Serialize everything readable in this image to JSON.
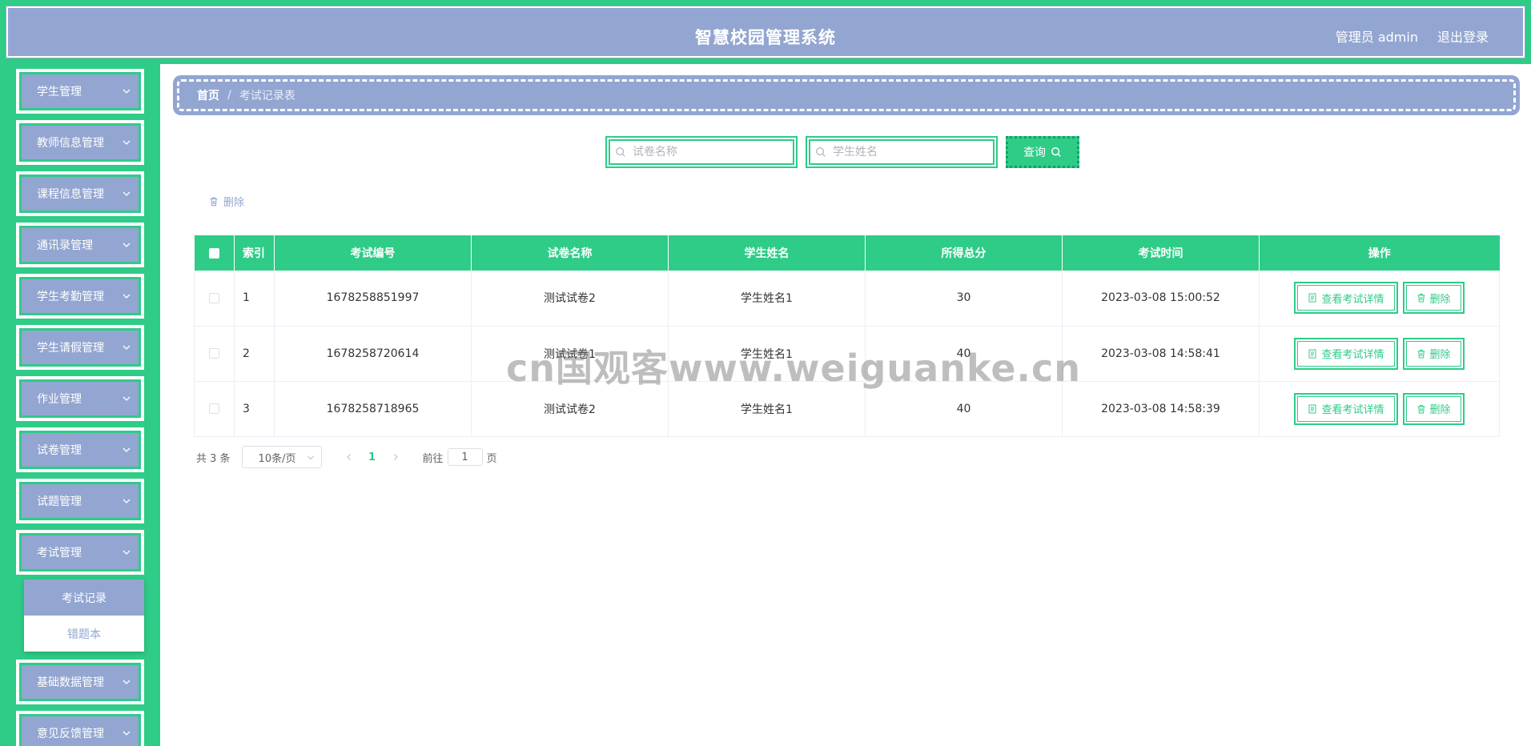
{
  "header": {
    "title": "智慧校园管理系统",
    "user": "管理员 admin",
    "logout": "退出登录"
  },
  "sidebar": {
    "items": [
      {
        "label": "学生管理"
      },
      {
        "label": "教师信息管理"
      },
      {
        "label": "课程信息管理"
      },
      {
        "label": "通讯录管理"
      },
      {
        "label": "学生考勤管理"
      },
      {
        "label": "学生请假管理"
      },
      {
        "label": "作业管理"
      },
      {
        "label": "试卷管理"
      },
      {
        "label": "试题管理"
      },
      {
        "label": "考试管理"
      },
      {
        "label": "基础数据管理"
      },
      {
        "label": "意见反馈管理"
      }
    ],
    "submenu": [
      {
        "label": "考试记录",
        "active": true
      },
      {
        "label": "错题本",
        "active": false
      }
    ]
  },
  "breadcrumb": {
    "home": "首页",
    "separator": "/",
    "current": "考试记录表"
  },
  "search": {
    "paper_placeholder": "试卷名称",
    "student_placeholder": "学生姓名",
    "query_label": "查询"
  },
  "toolbar": {
    "delete_label": "删除"
  },
  "table": {
    "columns": [
      "索引",
      "考试编号",
      "试卷名称",
      "学生姓名",
      "所得总分",
      "考试时间",
      "操作"
    ],
    "rows": [
      {
        "index": "1",
        "exam_no": "1678258851997",
        "paper": "测试试卷2",
        "student": "学生姓名1",
        "score": "30",
        "time": "2023-03-08 15:00:52"
      },
      {
        "index": "2",
        "exam_no": "1678258720614",
        "paper": "测试试卷1",
        "student": "学生姓名1",
        "score": "40",
        "time": "2023-03-08 14:58:41"
      },
      {
        "index": "3",
        "exam_no": "1678258718965",
        "paper": "测试试卷2",
        "student": "学生姓名1",
        "score": "40",
        "time": "2023-03-08 14:58:39"
      }
    ],
    "view_label": "查看考试详情",
    "delete_label": "删除"
  },
  "pagination": {
    "total": "共 3 条",
    "page_size": "10条/页",
    "current_page": "1",
    "goto_prefix": "前往",
    "goto_value": "1",
    "goto_suffix": "页"
  },
  "watermark": "cn国观客www.weiguanke.cn",
  "colors": {
    "accent": "#2ecc87",
    "primary": "#93a6d1"
  }
}
